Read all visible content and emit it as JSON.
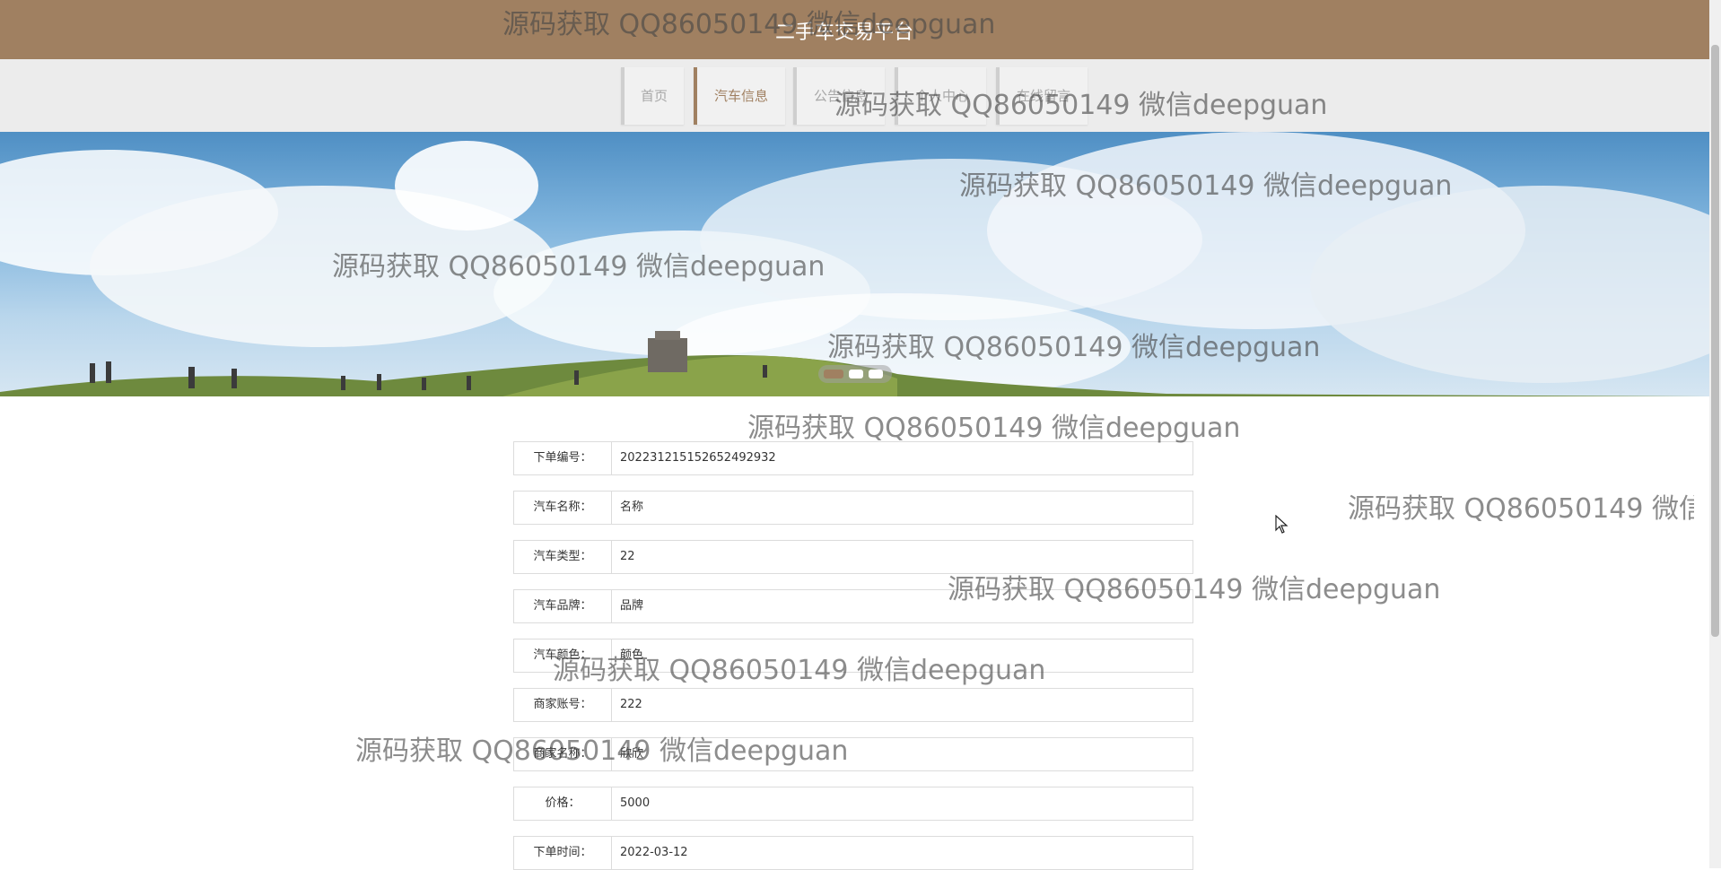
{
  "header": {
    "title": "二手车交易平台"
  },
  "nav": {
    "items": [
      {
        "label": "首页"
      },
      {
        "label": "汽车信息"
      },
      {
        "label": "公告信息"
      },
      {
        "label": "个人中心"
      },
      {
        "label": "在线留言"
      }
    ],
    "active_index": 1
  },
  "banner": {
    "slide_count": 3,
    "active_slide": 0
  },
  "order": {
    "fields": [
      {
        "label": "下单编号：",
        "value": "202231215152652492932"
      },
      {
        "label": "汽车名称：",
        "value": "名称"
      },
      {
        "label": "汽车类型：",
        "value": "22"
      },
      {
        "label": "汽车品牌：",
        "value": "品牌"
      },
      {
        "label": "汽车颜色：",
        "value": "颜色"
      },
      {
        "label": "商家账号：",
        "value": "222"
      },
      {
        "label": "商家名称：",
        "value": "欣欣"
      },
      {
        "label": "价格：",
        "value": "5000"
      },
      {
        "label": "下单时间：",
        "value": "2022-03-12"
      }
    ]
  },
  "watermark": {
    "text": "源码获取 QQ86050149 微信deepguan"
  },
  "colors": {
    "brand": "#a08061",
    "nav_bg": "#ececec"
  }
}
